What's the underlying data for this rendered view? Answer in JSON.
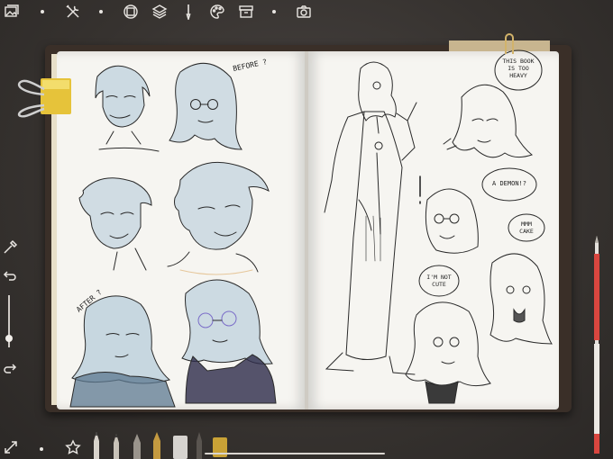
{
  "toolbar": {
    "icons": [
      "gallery-icon",
      "tools-icon",
      "layers-target-icon",
      "layers-icon",
      "brush-icon",
      "palette-icon",
      "archive-icon",
      "camera-icon"
    ]
  },
  "notebook": {
    "left_page": {
      "notes": {
        "before": "BEFORE ?",
        "after": "AFTER ?"
      }
    },
    "right_page": {
      "bubbles": {
        "this_book": "THIS BOOK\nIS TOO\nHEAVY",
        "demon": "A DEMON!?",
        "mmm": "MMM\nCAKE",
        "not_cute": "I'M NOT\nCUTE"
      },
      "exclaim": "!"
    }
  },
  "colors": {
    "background": "#3a3633",
    "paper": "#f6f5f1",
    "hair": "#a9c3d6",
    "ink": "#2a2a2a",
    "pen_red": "#d9463f",
    "clip_yellow": "#e6c33a"
  }
}
